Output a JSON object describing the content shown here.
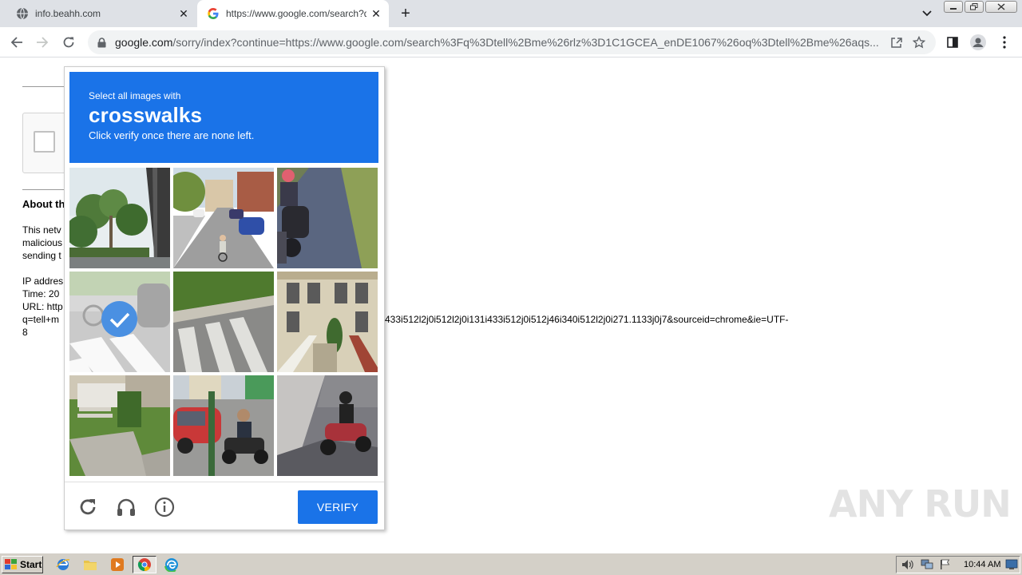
{
  "browser": {
    "tabs": [
      {
        "title": "info.beahh.com",
        "active": false
      },
      {
        "title": "https://www.google.com/search?q=",
        "active": true
      }
    ],
    "address": {
      "host": "google.com",
      "path": "/sorry/index?continue=https://www.google.com/search%3Fq%3Dtell%2Bme%26rlz%3D1C1GCEA_enDE1067%26oq%3Dtell%2Bme%26aqs..."
    }
  },
  "page": {
    "about_heading": "About th",
    "para1": [
      "This netv",
      "malicious",
      "sending t"
    ],
    "para2": [
      "IP addres",
      "Time: 20",
      "URL: http",
      "q=tell+m",
      "8"
    ],
    "url_tail": "433i512l2j0i512l2j0i131i433i512j0i512j46i340i512l2j0i271.1133j0j7&sourceid=chrome&ie=UTF-"
  },
  "captcha": {
    "instruction": "Select all images with",
    "target": "crosswalks",
    "hint": "Click verify once there are none left.",
    "verify_label": "VERIFY",
    "tiles": [
      {
        "scene": "trees-overpass",
        "selected": false
      },
      {
        "scene": "street-cyclist",
        "selected": false
      },
      {
        "scene": "motorcyclist-road",
        "selected": false
      },
      {
        "scene": "crosswalk-car",
        "selected": true
      },
      {
        "scene": "crosswalk-curb",
        "selected": false
      },
      {
        "scene": "victorian-house",
        "selected": false
      },
      {
        "scene": "house-stairs-lawn",
        "selected": false
      },
      {
        "scene": "red-car-motorbike",
        "selected": false
      },
      {
        "scene": "scooter-wall",
        "selected": false
      }
    ]
  },
  "watermark": "ANY RUN",
  "taskbar": {
    "start_label": "Start",
    "clock": "10:44 AM"
  },
  "colors": {
    "captcha_blue": "#1a73e8",
    "check_blue": "#4a90e2",
    "tab_strip": "#dee1e6",
    "taskbar": "#d4d0c8"
  }
}
